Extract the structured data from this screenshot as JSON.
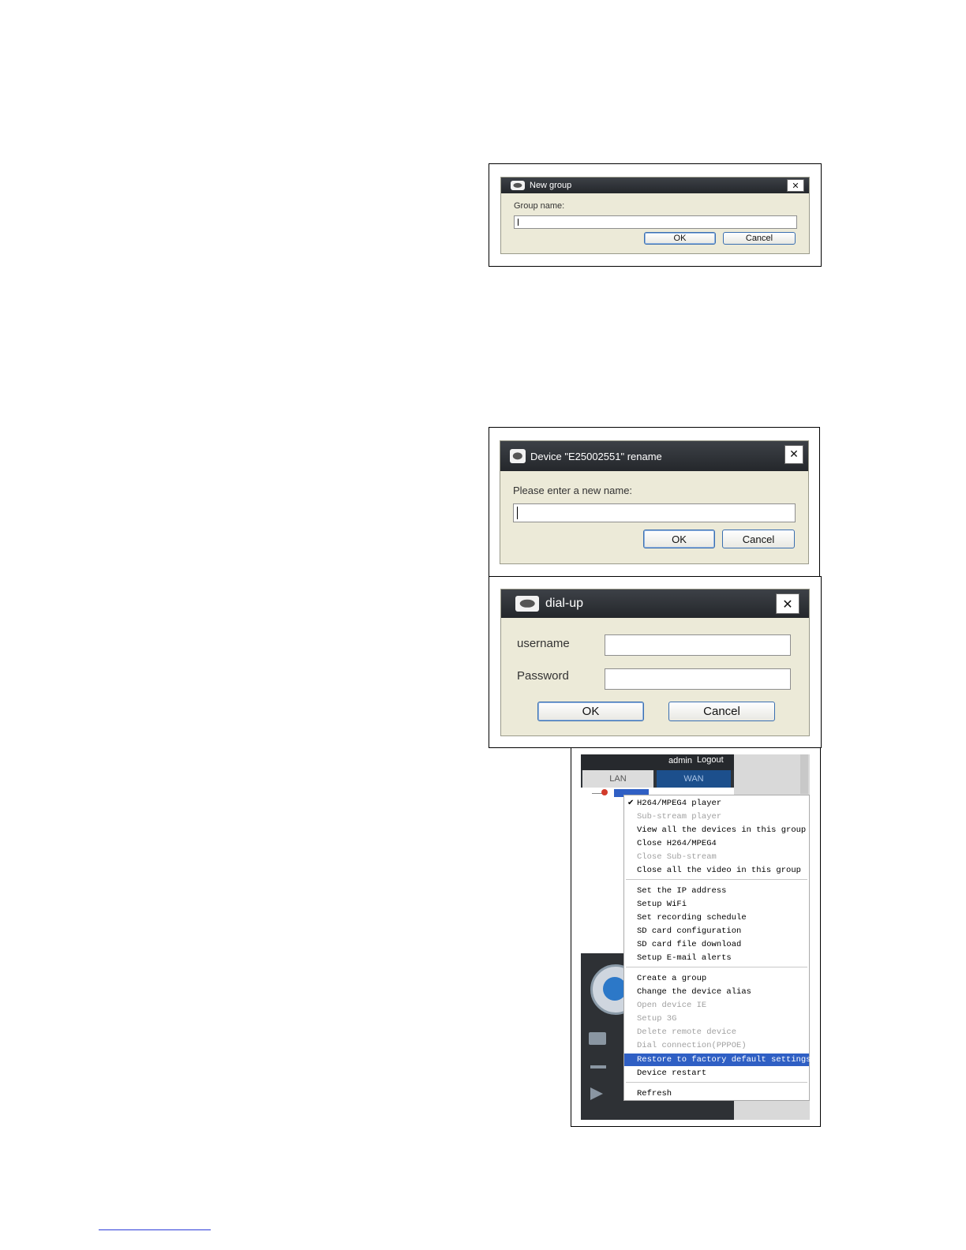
{
  "new_group": {
    "title": "New group",
    "field_label": "Group name:",
    "ok_label": "OK",
    "cancel_label": "Cancel",
    "close_symbol": "✕"
  },
  "rename": {
    "title": "Device \"E25002551\" rename",
    "field_label": "Please enter a new name:",
    "ok_label": "OK",
    "cancel_label": "Cancel",
    "close_symbol": "✕"
  },
  "dialup": {
    "title": "dial-up",
    "username_label": "username",
    "password_label": "Password",
    "ok_label": "OK",
    "cancel_label": "Cancel",
    "close_symbol": "✕"
  },
  "app": {
    "user": "admin",
    "logout": "Logout",
    "tabs": [
      "LAN",
      "WAN"
    ],
    "colors": {
      "wan_tab": "#1c4f8c",
      "highlight": "#2f5fc4"
    }
  },
  "context_menu": {
    "check_symbol": "✔",
    "items": [
      {
        "label": "H264/MPEG4 player",
        "checked": true
      },
      {
        "label": "Sub-stream player",
        "disabled": true
      },
      {
        "label": "View all the devices in this group"
      },
      {
        "label": "Close H264/MPEG4"
      },
      {
        "label": "Close Sub-stream",
        "disabled": true
      },
      {
        "label": "Close all the video in this group"
      },
      {
        "label": "Set the IP address"
      },
      {
        "label": "Setup WiFi"
      },
      {
        "label": "Set recording schedule"
      },
      {
        "label": "SD card configuration"
      },
      {
        "label": "SD card file download"
      },
      {
        "label": "Setup E-mail alerts"
      },
      {
        "label": "Create a group"
      },
      {
        "label": "Change the device alias"
      },
      {
        "label": "Open device IE",
        "disabled": true
      },
      {
        "label": "Setup 3G",
        "disabled": true
      },
      {
        "label": "Delete remote device",
        "disabled": true
      },
      {
        "label": "Dial connection(PPPOE)",
        "disabled": true
      },
      {
        "label": "Restore to factory default settings",
        "highlighted": true
      },
      {
        "label": "Device restart"
      },
      {
        "label": "Refresh"
      }
    ]
  }
}
